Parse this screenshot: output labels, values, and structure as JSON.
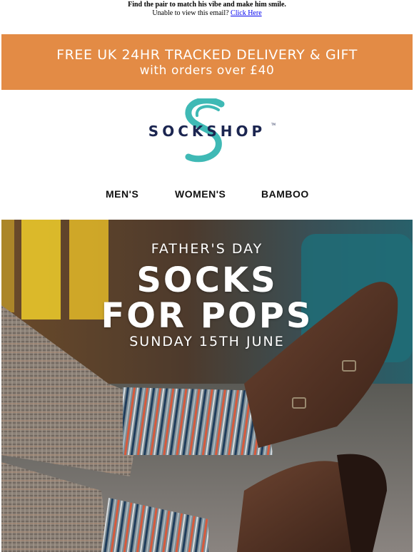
{
  "preheader": {
    "tagline": "Find the pair to match his vibe and make him smile.",
    "view_text": "Unable to view this email?",
    "view_link": "Click Here"
  },
  "promo": {
    "line1": "FREE UK 24HR TRACKED DELIVERY & GIFT",
    "line2": "with orders over £40",
    "color": "#e38b45"
  },
  "logo": {
    "text": "SOCKSHOP",
    "mark": "S",
    "trademark": "TM",
    "mark_color": "#3fb9b5",
    "text_color": "#1b2550"
  },
  "nav": {
    "items": [
      "MEN'S",
      "WOMEN'S",
      "BAMBOO"
    ]
  },
  "hero": {
    "kicker": "FATHER'S DAY",
    "headline_1": "SOCKS",
    "headline_2": "FOR POPS",
    "date": "SUNDAY 15TH JUNE",
    "image_icon": "father-feet-socks-photo"
  }
}
